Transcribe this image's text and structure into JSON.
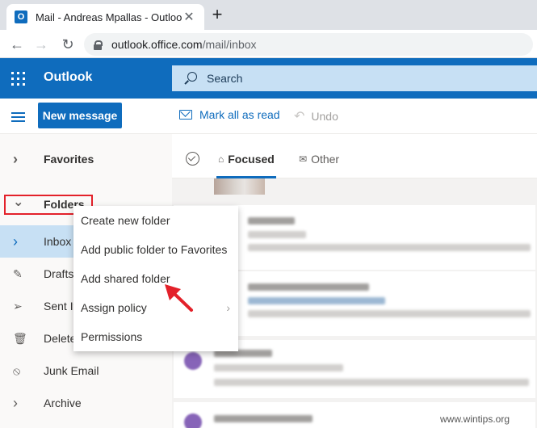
{
  "browser": {
    "tab_title": "Mail - Andreas Mpallas - Outlook",
    "tab_favicon_letter": "O",
    "close_glyph": "✕",
    "new_tab_glyph": "+",
    "back_glyph": "←",
    "forward_glyph": "→",
    "reload_glyph": "↻",
    "url_host": "outlook.office.com",
    "url_path": "/mail/inbox"
  },
  "header": {
    "brand": "Outlook",
    "search_placeholder": "Search"
  },
  "commandbar": {
    "new_message": "New message",
    "mark_all_read": "Mark all as read",
    "undo": "Undo"
  },
  "nav": {
    "favorites": "Favorites",
    "folders": "Folders",
    "inbox": "Inbox",
    "drafts": "Drafts",
    "sent": "Sent It",
    "deleted": "Delete",
    "junk": "Junk Email",
    "archive": "Archive",
    "chevron_right": "›",
    "chevron_down": "⌄"
  },
  "list": {
    "tab_focused": "Focused",
    "tab_other": "Other"
  },
  "context_menu": {
    "items": [
      "Create new folder",
      "Add public folder to Favorites",
      "Add shared folder",
      "Assign policy",
      "Permissions"
    ],
    "submenu_chevron": "›"
  },
  "watermark": "www.wintips.org",
  "colors": {
    "brand_blue": "#0f6cbd",
    "annotation_red": "#e3212a"
  }
}
